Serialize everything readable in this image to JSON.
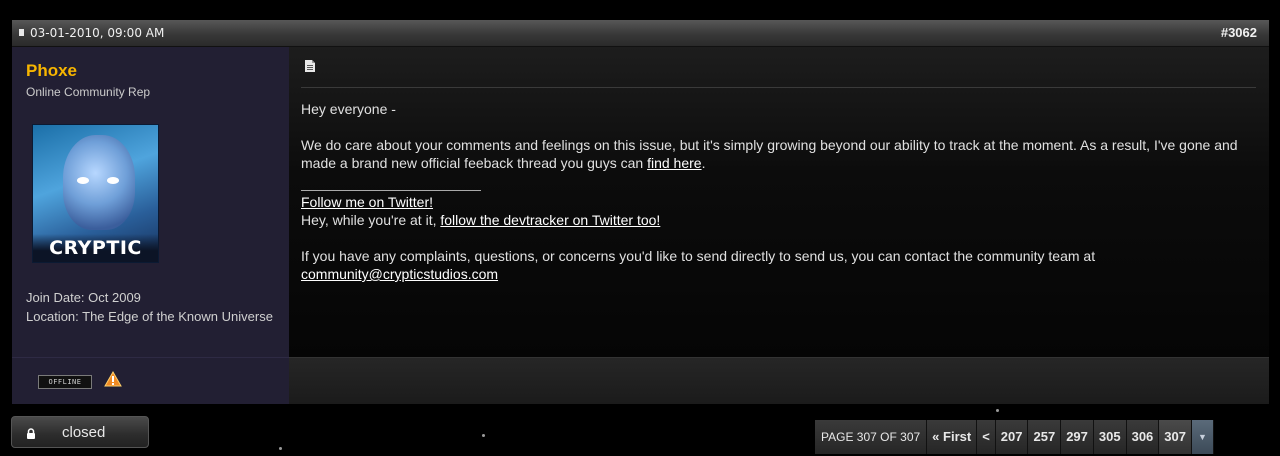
{
  "post": {
    "date": "03-01-2010, 09:00 AM",
    "number": "#3062"
  },
  "user": {
    "name": "Phoxe",
    "title": "Online Community Rep",
    "avatar_logo": "CRYPTIC",
    "join_date": "Join Date: Oct 2009",
    "location": "Location: The Edge of the Known Universe",
    "status": "OFFLINE"
  },
  "message": {
    "greeting": "Hey everyone -",
    "para1": "We do care about your comments and feelings on this issue, but it's simply growing beyond our ability to track at the moment. As a result, I've gone and made a brand new official feeback thread you guys can ",
    "para1_link": "find here",
    "para1_end": ".",
    "sig_link1": "Follow me on Twitter!",
    "sig_text2": "Hey, while you're at it, ",
    "sig_link2": "follow the devtracker on Twitter too!",
    "para3": "If you have any complaints, questions, or concerns you'd like to send directly to send us, you can contact the community team at ",
    "para3_email": "community@crypticstudios.com"
  },
  "thread": {
    "closed_label": "closed"
  },
  "pagination": {
    "label": "PAGE 307 OF 307",
    "first": "« First",
    "prev": "<",
    "pages": [
      "207",
      "257",
      "297",
      "305",
      "306",
      "307"
    ],
    "menu": "▼"
  },
  "colors": {
    "username": "#f7b500",
    "userinfo_bg": "#221f33",
    "header_bg": "#3a3a3a"
  },
  "icons": [
    "document-icon",
    "lock-icon",
    "warning-icon"
  ]
}
